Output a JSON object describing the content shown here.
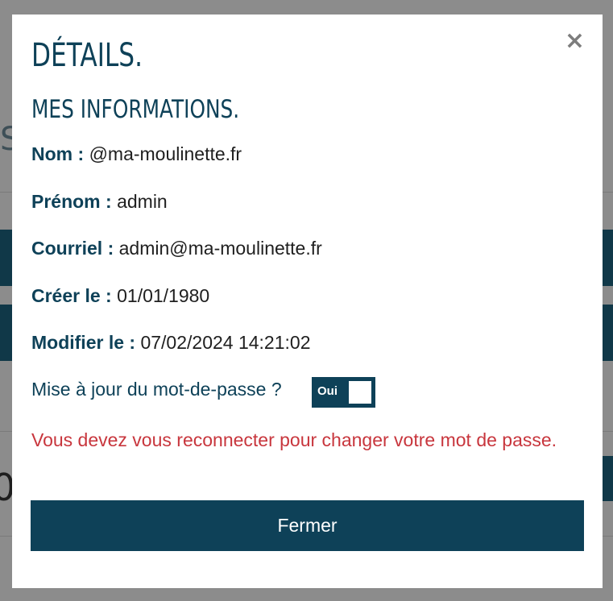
{
  "background": {
    "peek_letter": "S",
    "peek_digit": "0"
  },
  "modal": {
    "close_glyph": "×",
    "title": "DÉTAILS.",
    "subtitle": "MES INFORMATIONS.",
    "fields": [
      {
        "label": "Nom :",
        "value": "@ma-moulinette.fr"
      },
      {
        "label": "Prénom :",
        "value": "admin"
      },
      {
        "label": "Courriel :",
        "value": "admin@ma-moulinette.fr"
      },
      {
        "label": "Créer le :",
        "value": "01/01/1980"
      },
      {
        "label": "Modifier le :",
        "value": "07/02/2024 14:21:02"
      }
    ],
    "password_update": {
      "question": "Mise à jour du mot-de-passe ?",
      "toggle_label": "Oui",
      "toggle_on": true
    },
    "warning": "Vous devez vous reconnecter pour changer votre mot de passe.",
    "close_button_label": "Fermer"
  },
  "colors": {
    "primary": "#0e4158",
    "warning": "#c8363d",
    "overlay": "#8c8c8c"
  }
}
